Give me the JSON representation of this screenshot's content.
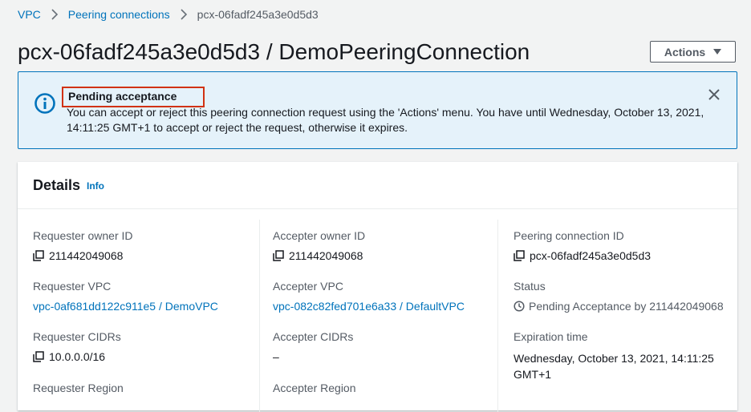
{
  "breadcrumb": {
    "items": [
      "VPC",
      "Peering connections",
      "pcx-06fadf245a3e0d5d3"
    ]
  },
  "header": {
    "title": "pcx-06fadf245a3e0d5d3 / DemoPeeringConnection",
    "actions_label": "Actions"
  },
  "alert": {
    "title": "Pending acceptance",
    "message_line1": "You can accept or reject this peering connection request using the 'Actions' menu. You have until Wednesday, October 13, 2021,",
    "message_line2": "14:11:25 GMT+1 to accept or reject the request, otherwise it expires."
  },
  "details": {
    "title": "Details",
    "info_label": "Info",
    "requester_owner_id": {
      "label": "Requester owner ID",
      "value": "211442049068"
    },
    "requester_vpc": {
      "label": "Requester VPC",
      "value": "vpc-0af681dd122c911e5 / DemoVPC"
    },
    "requester_cidrs": {
      "label": "Requester CIDRs",
      "value": "10.0.0.0/16"
    },
    "requester_region": {
      "label": "Requester Region"
    },
    "accepter_owner_id": {
      "label": "Accepter owner ID",
      "value": "211442049068"
    },
    "accepter_vpc": {
      "label": "Accepter VPC",
      "value": "vpc-082c82fed701e6a33 / DefaultVPC"
    },
    "accepter_cidrs": {
      "label": "Accepter CIDRs",
      "value": "–"
    },
    "accepter_region": {
      "label": "Accepter Region"
    },
    "peering_connection_id": {
      "label": "Peering connection ID",
      "value": "pcx-06fadf245a3e0d5d3"
    },
    "status": {
      "label": "Status",
      "value": "Pending Acceptance by 211442049068"
    },
    "expiration_time": {
      "label": "Expiration time",
      "value_line1": "Wednesday, October 13, 2021, 14:11:25",
      "value_line2": "GMT+1"
    }
  },
  "icons": {
    "info": "info-circle-icon",
    "close": "close-icon",
    "copy": "copy-icon",
    "status": "clock-icon"
  },
  "colors": {
    "link": "#0073bb",
    "alert_bg": "#e5f2fa",
    "alert_border": "#0073bb",
    "highlight": "#d13212"
  }
}
